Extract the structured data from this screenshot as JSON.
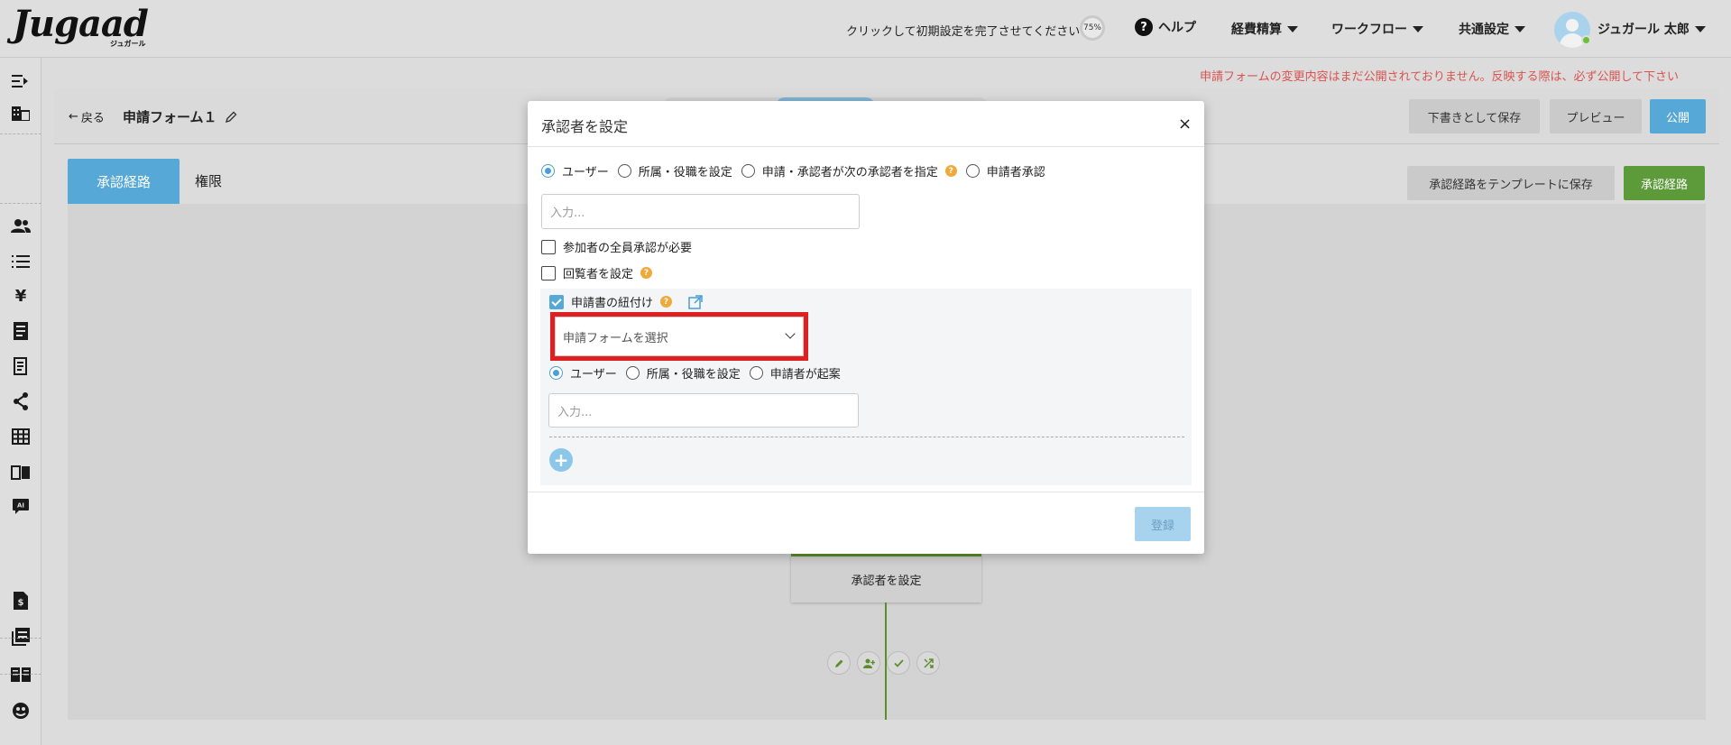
{
  "app": {
    "logo_text": "Jugaad",
    "logo_sub": "ジュガール"
  },
  "header": {
    "setup_prompt": "クリックして初期設定を完了させてください →",
    "setup_progress": "75%",
    "help_label": "ヘルプ",
    "menus": [
      "経費精算",
      "ワークフロー",
      "共通設定"
    ],
    "user_name": "ジュガール 太郎"
  },
  "notice": {
    "unpublished_warning": "申請フォームの変更内容はまだ公開されておりません。反映する際は、必ず公開して下さい"
  },
  "toolbar": {
    "back_label": "戻る",
    "form_title": "申請フォーム１",
    "save_draft_label": "下書きとして保存",
    "preview_label": "プレビュー",
    "publish_label": "公開"
  },
  "tabs": {
    "approval_route": "承認経路",
    "permissions": "権限"
  },
  "route_actions": {
    "save_template_label": "承認経路をテンプレートに保存",
    "route_label": "承認経路"
  },
  "flow": {
    "node_label": "承認者を設定"
  },
  "modal": {
    "title": "承認者を設定",
    "close_label": "×",
    "approver_type_options": [
      "ユーザー",
      "所属・役職を設定",
      "申請・承認者が次の承認者を指定",
      "申請者承認"
    ],
    "approver_type_selected": "ユーザー",
    "user_input_placeholder": "入力...",
    "require_all_label": "参加者の全員承認が必要",
    "set_viewer_label": "回覧者を設定",
    "link_application_label": "申請書の紐付け",
    "form_select_placeholder": "申請フォームを選択",
    "linked_options": [
      "ユーザー",
      "所属・役職を設定",
      "申請者が起案"
    ],
    "linked_selected": "ユーザー",
    "linked_input_placeholder": "入力...",
    "add_label": "+",
    "register_label": "登録"
  },
  "colors": {
    "accent_blue": "#56a8d6",
    "accent_green": "#5d9a3a",
    "warning_red": "#d9534f",
    "highlight_red": "#e02020",
    "help_orange": "#f0a93a"
  }
}
